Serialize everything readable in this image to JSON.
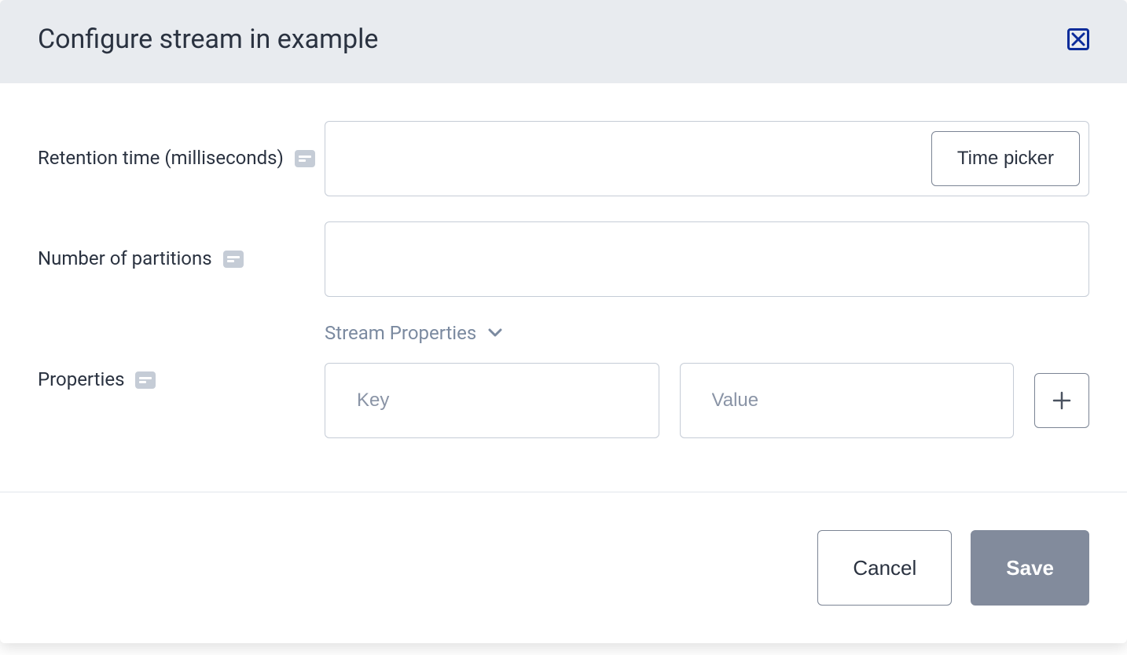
{
  "modal": {
    "title": "Configure stream in example"
  },
  "form": {
    "retention": {
      "label": "Retention time (milliseconds)",
      "value": "",
      "time_picker_label": "Time picker"
    },
    "partitions": {
      "label": "Number of partitions",
      "value": ""
    },
    "properties": {
      "label": "Properties",
      "section_title": "Stream Properties",
      "key_placeholder": "Key",
      "value_placeholder": "Value",
      "key": "",
      "value": ""
    }
  },
  "footer": {
    "cancel": "Cancel",
    "save": "Save"
  }
}
